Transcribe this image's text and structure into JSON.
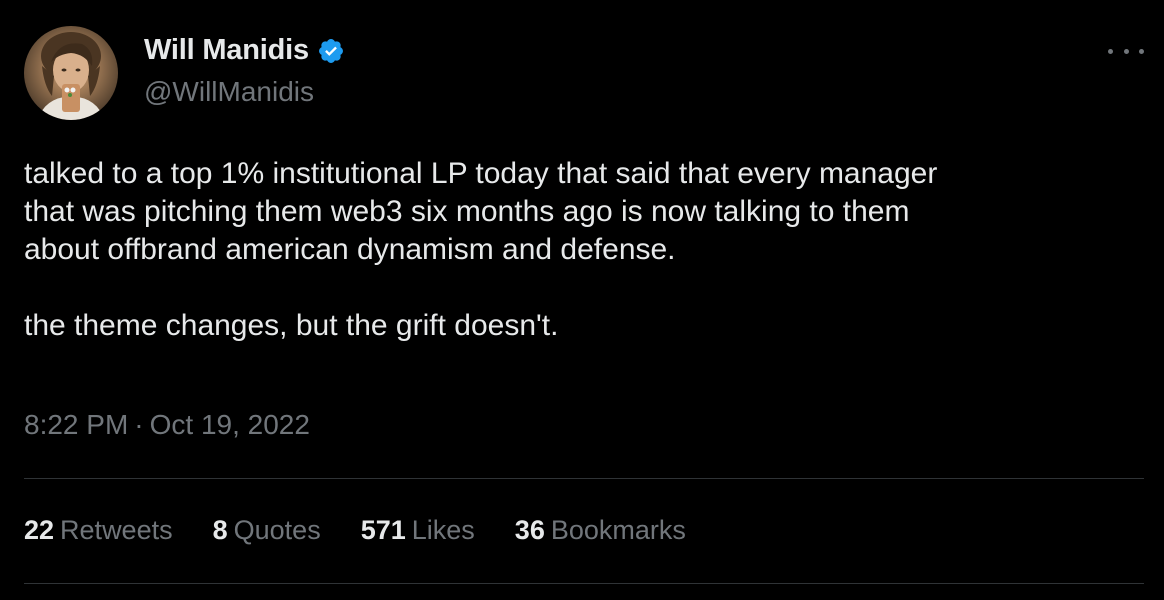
{
  "author": {
    "display_name": "Will Manidis",
    "handle": "@WillManidis",
    "verified": true,
    "verified_color": "#1d9bf0",
    "avatar_icon": "profile-photo"
  },
  "more_icon": "ellipsis-icon",
  "tweet": {
    "text": "talked to a top 1% institutional LP today that said that every manager\nthat was pitching them web3 six months ago is now talking to them\nabout offbrand american dynamism and defense.\n\nthe theme changes, but the grift doesn't."
  },
  "meta": {
    "time": "8:22 PM",
    "separator": "·",
    "date": "Oct 19, 2022"
  },
  "stats": [
    {
      "count": "22",
      "label": "Retweets"
    },
    {
      "count": "8",
      "label": "Quotes"
    },
    {
      "count": "571",
      "label": "Likes"
    },
    {
      "count": "36",
      "label": "Bookmarks"
    }
  ],
  "colors": {
    "background": "#000000",
    "text_primary": "#e7e9ea",
    "text_secondary": "#71767b",
    "divider": "#2f3336"
  }
}
